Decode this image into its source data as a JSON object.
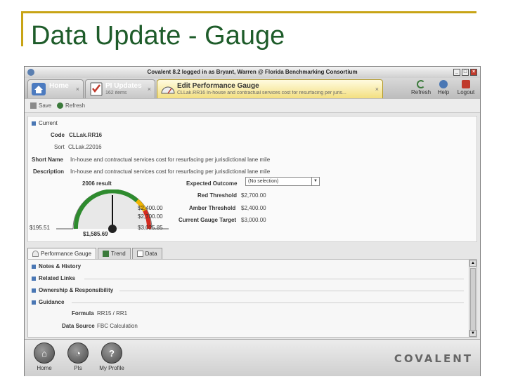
{
  "slide": {
    "title": "Data Update - Gauge"
  },
  "window": {
    "title": "Covalent 8.2   logged in as Bryant, Warren @ Florida Benchmarking Consortium"
  },
  "tabs": [
    {
      "label": "Home",
      "subtitle": ""
    },
    {
      "label": "PI Updates",
      "subtitle": "162 items"
    },
    {
      "label": "Edit Performance Gauge",
      "subtitle": "CLLak.RR16 In-house and contractual services cost for resurfacing per juris..."
    }
  ],
  "right_tools": {
    "refresh": "Refresh",
    "help": "Help",
    "logout": "Logout"
  },
  "toolbar": {
    "save": "Save",
    "refresh": "Refresh"
  },
  "current": {
    "heading": "Current",
    "code_label": "Code",
    "code_value": "CLLak.RR16",
    "sort_label": "Sort",
    "sort_value": "CLLak.22016",
    "short_name_label": "Short Name",
    "short_name_value": "In-house and contractual services cost for resurfacing per jurisdictional lane mile",
    "description_label": "Description",
    "description_value": "In-house and contractual services cost for resurfacing per jurisdictional lane mile",
    "result_label": "2006 result",
    "expected_outcome_label": "Expected Outcome",
    "expected_outcome_value": "(No selection)",
    "red_threshold_label": "Red Threshold",
    "red_threshold_value": "$2,700.00",
    "amber_threshold_label": "Amber Threshold",
    "amber_threshold_value": "$2,400.00",
    "gauge_target_label": "Current Gauge Target",
    "gauge_target_value": "$3,000.00"
  },
  "gauge": {
    "min": "$195.51",
    "value": "$1,585.69",
    "mark1": "$2,400.00",
    "mark2": "$2,700.00",
    "max": "$3,025.85",
    "colors": {
      "green": "#2e8b2e",
      "amber": "#f0b400",
      "red": "#d42a1f"
    }
  },
  "lower_tabs": {
    "gauge": "Performance Gauge",
    "trend": "Trend",
    "data": "Data"
  },
  "lower": {
    "notes": "Notes & History",
    "links": "Related Links",
    "ownership": "Ownership & Responsibility",
    "guidance": "Guidance",
    "formula_label": "Formula",
    "formula_value": "RR15 / RR1",
    "datasource_label": "Data Source",
    "datasource_value": "FBC Calculation"
  },
  "footer": {
    "home": "Home",
    "pis": "PIs",
    "profile": "My Profile",
    "brand": "COVALENT"
  }
}
